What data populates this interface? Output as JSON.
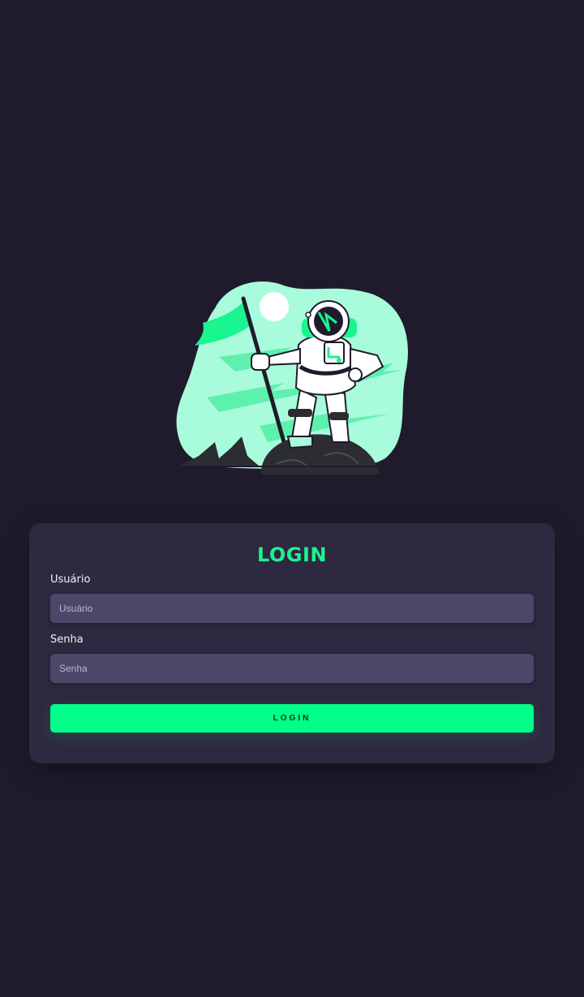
{
  "hero": {
    "illustration": "astronaut-planting-flag",
    "accent_color": "#19f58f",
    "blob_color": "#a8fcdb"
  },
  "login": {
    "title": "LOGIN",
    "user_label": "Usuário",
    "user_placeholder": "Usuário",
    "password_label": "Senha",
    "password_placeholder": "Senha",
    "submit_label": "LOGIN"
  },
  "colors": {
    "background": "#1f1b2c",
    "card": "#2e2840",
    "input": "#4e4668",
    "accent": "#00ff88"
  }
}
